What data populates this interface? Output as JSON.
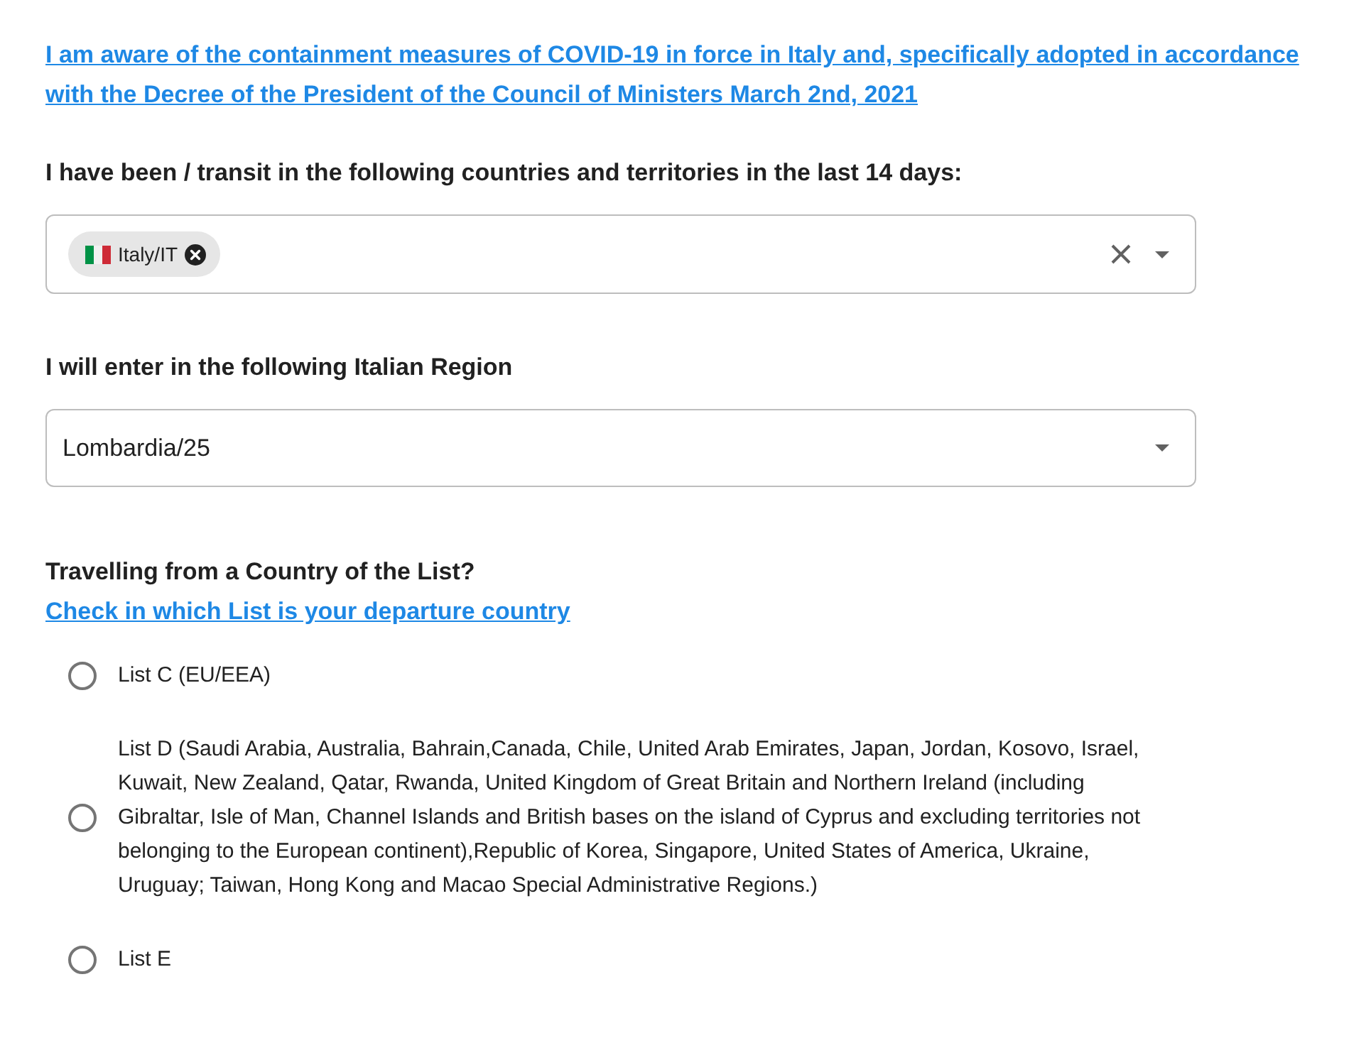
{
  "consent_link": "I am aware of the containment measures of COVID-19 in force in Italy and, specifically adopted in accordance with the Decree of the President of the Council of Ministers March 2nd, 2021",
  "countries_field": {
    "label": "I have been / transit in the following countries and territories in the last 14 days:",
    "chips": [
      {
        "label": "Italy/IT"
      }
    ]
  },
  "region_field": {
    "label": "I will enter in the following Italian Region",
    "value": "Lombardia/25"
  },
  "list_question": {
    "label": "Travelling from a Country of the List?",
    "link": "Check in which List is your departure country"
  },
  "list_options": [
    {
      "label": "List C (EU/EEA)",
      "selected": false
    },
    {
      "label": "List D (Saudi Arabia, Australia, Bahrain,Canada, Chile, United Arab Emirates, Japan, Jordan, Kosovo, Israel, Kuwait, New Zealand, Qatar, Rwanda, United Kingdom of Great Britain and Northern Ireland (including Gibraltar, Isle of Man, Channel Islands and British bases on the island of Cyprus and excluding territories not belonging to the European continent),Republic of Korea, Singapore, United States of America, Ukraine, Uruguay; Taiwan, Hong Kong and Macao Special Administrative Regions.)",
      "selected": false
    },
    {
      "label": "List E",
      "selected": false
    }
  ]
}
